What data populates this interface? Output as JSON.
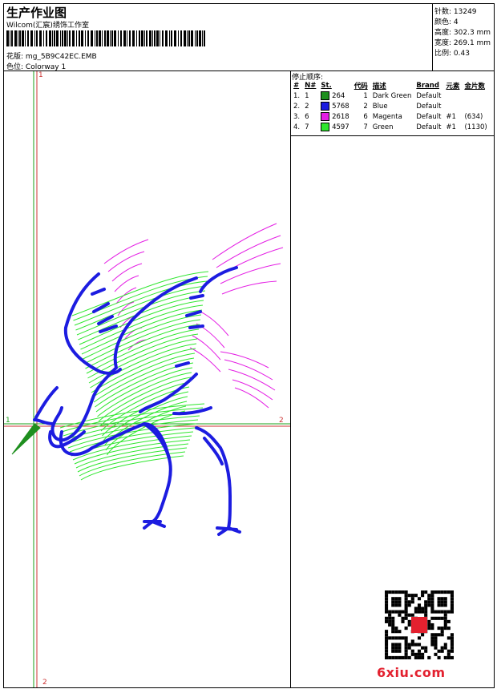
{
  "header": {
    "title": "生产作业图",
    "company": "Wilcom(汇宸)绣饰工作室",
    "design_label": "花版:",
    "design_value": "mg_5B9C42EC.EMB",
    "colorway_label": "色位:",
    "colorway_value": "Colorway 1"
  },
  "stats": [
    {
      "label": "针数:",
      "value": "13249"
    },
    {
      "label": "颜色:",
      "value": "4"
    },
    {
      "label": "高度:",
      "value": "302.3 mm"
    },
    {
      "label": "宽度:",
      "value": "269.1 mm"
    },
    {
      "label": "比例:",
      "value": "0.43"
    }
  ],
  "stop_sequence": {
    "heading": "停止顺序:",
    "columns": [
      "#",
      "N#",
      "St.",
      "代码",
      "描述",
      "Brand",
      "元素",
      "金片数"
    ],
    "rows": [
      {
        "num": "1.",
        "n": "1",
        "color": "#1f8f1f",
        "st": "264",
        "code": "1",
        "desc": "Dark Green",
        "brand": "Default",
        "element": "",
        "sequin": ""
      },
      {
        "num": "2.",
        "n": "2",
        "color": "#1c1ce0",
        "st": "5768",
        "code": "2",
        "desc": "Blue",
        "brand": "Default",
        "element": "",
        "sequin": ""
      },
      {
        "num": "3.",
        "n": "6",
        "color": "#e41ee4",
        "st": "2618",
        "code": "6",
        "desc": "Magenta",
        "brand": "Default",
        "element": "#1",
        "sequin": "(634)"
      },
      {
        "num": "4.",
        "n": "7",
        "color": "#2ee62e",
        "st": "4597",
        "code": "7",
        "desc": "Green",
        "brand": "Default",
        "element": "#1",
        "sequin": "(1130)"
      }
    ]
  },
  "axes": {
    "top_label": "1",
    "left_label": "1",
    "right_label": "2",
    "bottom_label": "2"
  },
  "colors": {
    "dark_green": "#1f8f1f",
    "blue": "#1c1ce0",
    "magenta": "#e41ee4",
    "green": "#2ee62e",
    "axis_green": "#1aa01a",
    "axis_red": "#cc3333"
  },
  "watermark": {
    "site": "6xiu.com"
  }
}
